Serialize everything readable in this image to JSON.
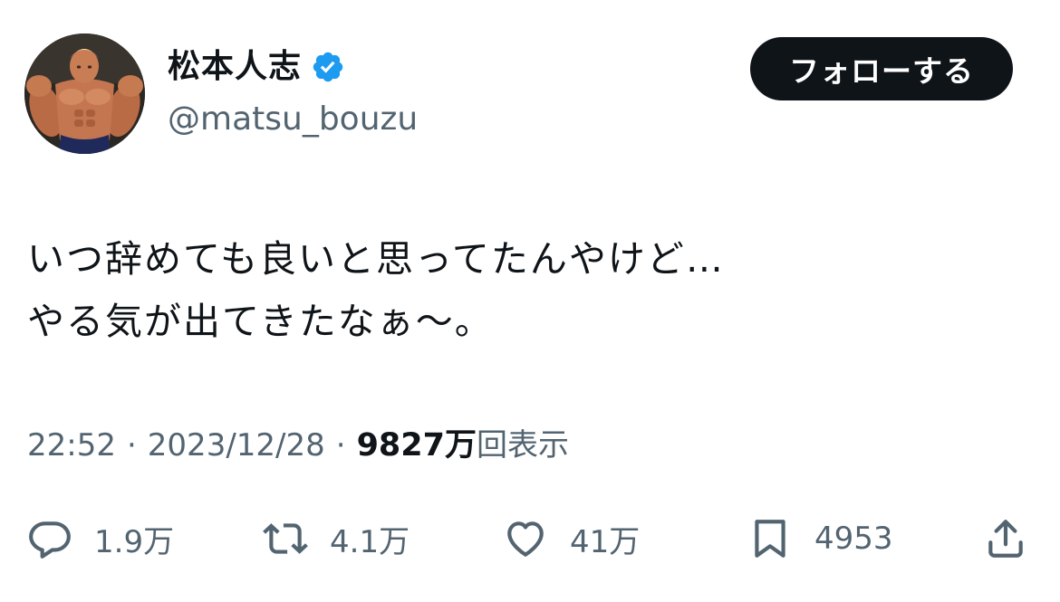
{
  "user": {
    "display_name": "松本人志",
    "handle": "@matsu_bouzu",
    "verified_icon": "verified-badge-icon",
    "verified_color": "#1d9bf0"
  },
  "follow_button": {
    "label": "フォローする",
    "color": "#0f1419"
  },
  "tweet": {
    "lines": [
      "いつ辞めても良いと思ってたんやけど…",
      "やる気が出てきたなぁ〜。"
    ]
  },
  "meta": {
    "time": "22:52",
    "separator": "·",
    "date": "2023/12/28",
    "views_count": "9827万",
    "views_label": "回表示"
  },
  "actions": {
    "reply": {
      "icon": "reply-icon",
      "count": "1.9万"
    },
    "retweet": {
      "icon": "retweet-icon",
      "count": "4.1万"
    },
    "like": {
      "icon": "heart-icon",
      "count": "41万"
    },
    "bookmark": {
      "icon": "bookmark-icon",
      "count": "4953"
    },
    "share": {
      "icon": "share-icon"
    }
  },
  "colors": {
    "text_primary": "#0f1419",
    "text_secondary": "#536471",
    "background": "#ffffff"
  }
}
